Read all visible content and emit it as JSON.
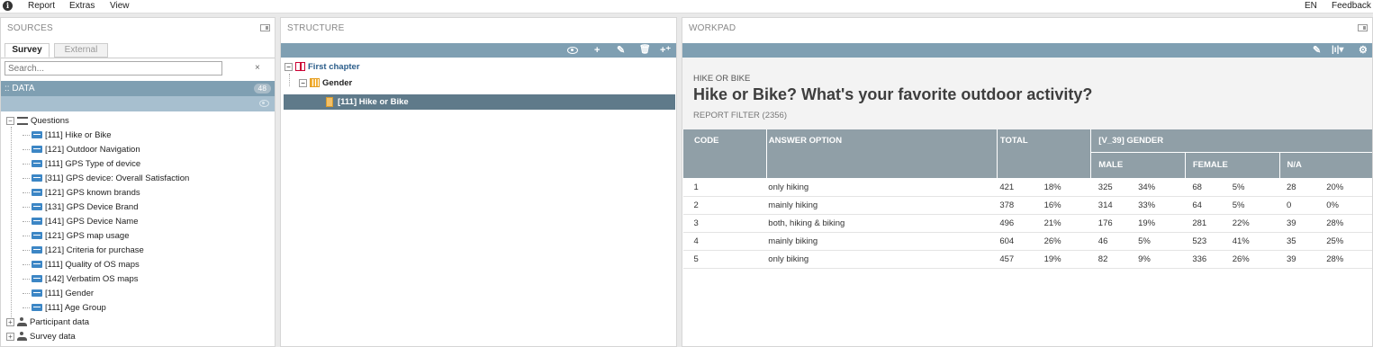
{
  "menubar": {
    "info_icon": "i",
    "items": [
      "Report",
      "Extras",
      "View"
    ],
    "lang": "EN",
    "feedback": "Feedback"
  },
  "sources": {
    "title": "SOURCES",
    "tabs": [
      "Survey",
      "External"
    ],
    "search_placeholder": "Search...",
    "clear": "×",
    "data_label": ":: DATA",
    "data_count": "48",
    "tree": {
      "questions_label": "Questions",
      "questions": [
        "[111] Hike or Bike",
        "[121] Outdoor Navigation",
        "[111] GPS Type of device",
        "[311] GPS device: Overall Satisfaction",
        "[121] GPS known brands",
        "[131] GPS Device Brand",
        "[141] GPS Device Name",
        "[121] GPS map usage",
        "[121] Criteria for purchase",
        "[111] Quality of OS maps",
        "[142] Verbatim OS maps",
        "[111] Gender",
        "[111] Age Group"
      ],
      "participant_label": "Participant data",
      "survey_label": "Survey data"
    }
  },
  "structure": {
    "title": "STRUCTURE",
    "toolbar": {
      "add": "+",
      "add_sub": "+⁺"
    },
    "chapter": "First chapter",
    "gender": "Gender",
    "selected": "[111] Hike or Bike"
  },
  "workpad": {
    "title": "WORKPAD",
    "kicker": "HIKE OR BIKE",
    "heading": "Hike or Bike? What's your favorite outdoor activity?",
    "filter": "REPORT FILTER (2356)",
    "toolbar_chart": "|ı|▾",
    "table": {
      "headers": {
        "code": "CODE",
        "answer": "ANSWER OPTION",
        "total": "TOTAL",
        "group": "[V_39] GENDER",
        "male": "MALE",
        "female": "FEMALE",
        "na": "N/A"
      },
      "rows": [
        {
          "code": "1",
          "answer": "only hiking",
          "total": "421",
          "total_pct": "18%",
          "male": "325",
          "male_pct": "34%",
          "female": "68",
          "female_pct": "5%",
          "na": "28",
          "na_pct": "20%"
        },
        {
          "code": "2",
          "answer": "mainly hiking",
          "total": "378",
          "total_pct": "16%",
          "male": "314",
          "male_pct": "33%",
          "female": "64",
          "female_pct": "5%",
          "na": "0",
          "na_pct": "0%"
        },
        {
          "code": "3",
          "answer": "both, hiking & biking",
          "total": "496",
          "total_pct": "21%",
          "male": "176",
          "male_pct": "19%",
          "female": "281",
          "female_pct": "22%",
          "na": "39",
          "na_pct": "28%"
        },
        {
          "code": "4",
          "answer": "mainly biking",
          "total": "604",
          "total_pct": "26%",
          "male": "46",
          "male_pct": "5%",
          "female": "523",
          "female_pct": "41%",
          "na": "35",
          "na_pct": "25%"
        },
        {
          "code": "5",
          "answer": "only biking",
          "total": "457",
          "total_pct": "19%",
          "male": "82",
          "male_pct": "9%",
          "female": "336",
          "female_pct": "26%",
          "na": "39",
          "na_pct": "28%"
        }
      ]
    }
  }
}
